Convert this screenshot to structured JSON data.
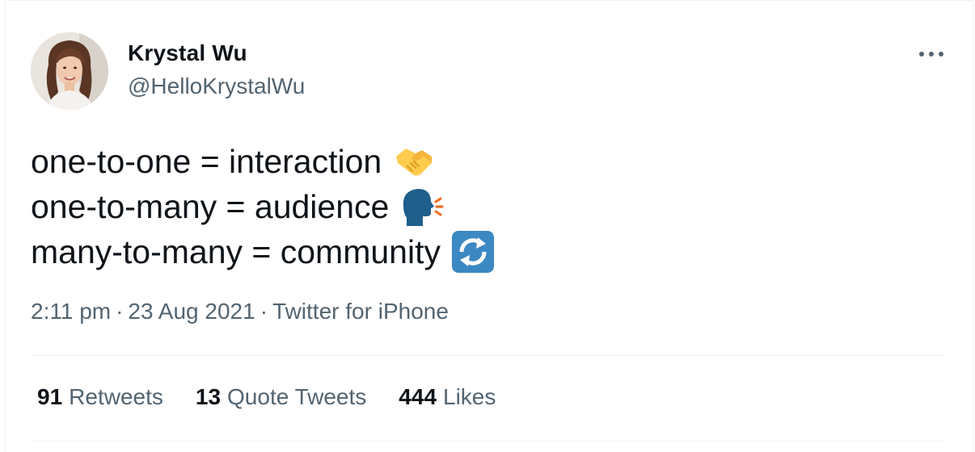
{
  "author": {
    "display_name": "Krystal Wu",
    "handle": "@HelloKrystalWu"
  },
  "tweet": {
    "lines": [
      {
        "text": "one-to-one = interaction",
        "emoji": "handshake-emoji"
      },
      {
        "text": "one-to-many = audience",
        "emoji": "speaking-head-emoji"
      },
      {
        "text": "many-to-many = community",
        "emoji": "counterclockwise-arrows-button-emoji"
      }
    ]
  },
  "meta": {
    "time": "2:11 pm",
    "separator": "·",
    "date": "23 Aug 2021",
    "source": "Twitter for iPhone"
  },
  "stats": {
    "retweets": {
      "count": "91",
      "label": "Retweets"
    },
    "quote_tweets": {
      "count": "13",
      "label": "Quote Tweets"
    },
    "likes": {
      "count": "444",
      "label": "Likes"
    }
  },
  "colors": {
    "primary_text": "#0f1419",
    "secondary_text": "#536471",
    "divider": "#eff3f4"
  }
}
